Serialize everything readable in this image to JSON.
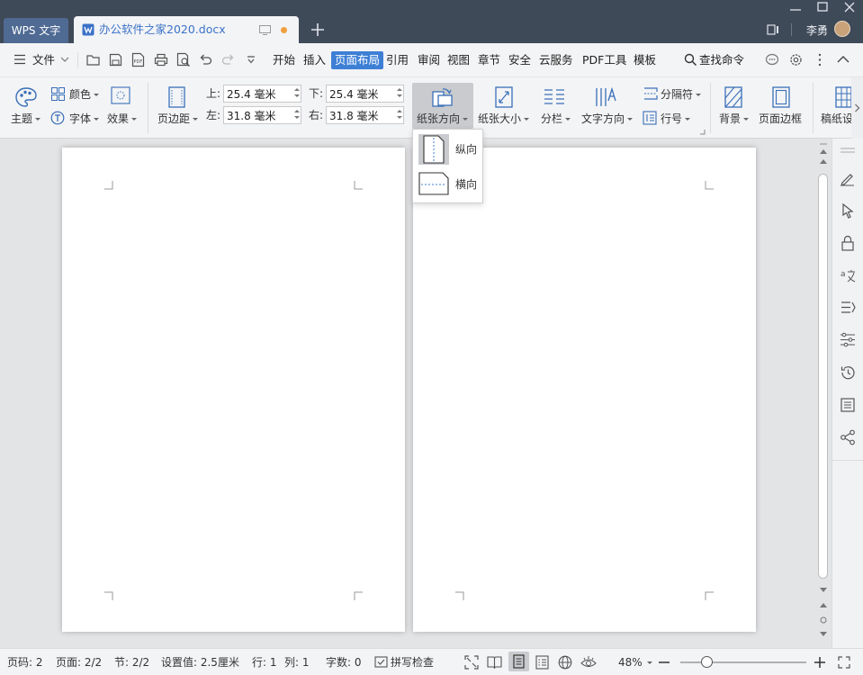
{
  "titlebar": {
    "app_tab": "WPS 文字",
    "doc_tab": "办公软件之家2020.docx",
    "user_name": "李勇"
  },
  "menubar": {
    "file": "文件",
    "tabs": [
      "开始",
      "插入",
      "页面布局",
      "引用",
      "审阅",
      "视图",
      "章节",
      "安全",
      "云服务",
      "PDF工具",
      "模板"
    ],
    "active_tab": "页面布局",
    "search": "查找命令"
  },
  "ribbon": {
    "theme": "主题",
    "color": "颜色",
    "font": "字体",
    "effect": "效果",
    "margins": "页边距",
    "margin_top_label": "上:",
    "margin_top": "25.4 毫米",
    "margin_bottom_label": "下:",
    "margin_bottom": "25.4 毫米",
    "margin_left_label": "左:",
    "margin_left": "31.8 毫米",
    "margin_right_label": "右:",
    "margin_right": "31.8 毫米",
    "orientation": "纸张方向",
    "paper_size": "纸张大小",
    "columns": "分栏",
    "text_direction": "文字方向",
    "separator": "分隔符",
    "line_numbers": "行号",
    "background": "背景",
    "page_border": "页面边框",
    "manuscript": "稿纸设"
  },
  "dropdown": {
    "portrait": "纵向",
    "landscape": "横向"
  },
  "statusbar": {
    "page_no": "页码: 2",
    "page_count": "页面: 2/2",
    "section": "节: 2/2",
    "setting": "设置值: 2.5厘米",
    "row": "行: 1",
    "col": "列: 1",
    "word_count": "字数: 0",
    "spell_check": "拼写检查",
    "zoom": "48%"
  },
  "colors": {
    "titlebar": "#3f4a59",
    "accent": "#3e7fd6",
    "doc_tab_text": "#3b72c8",
    "unsaved_dot": "#f0a040"
  }
}
